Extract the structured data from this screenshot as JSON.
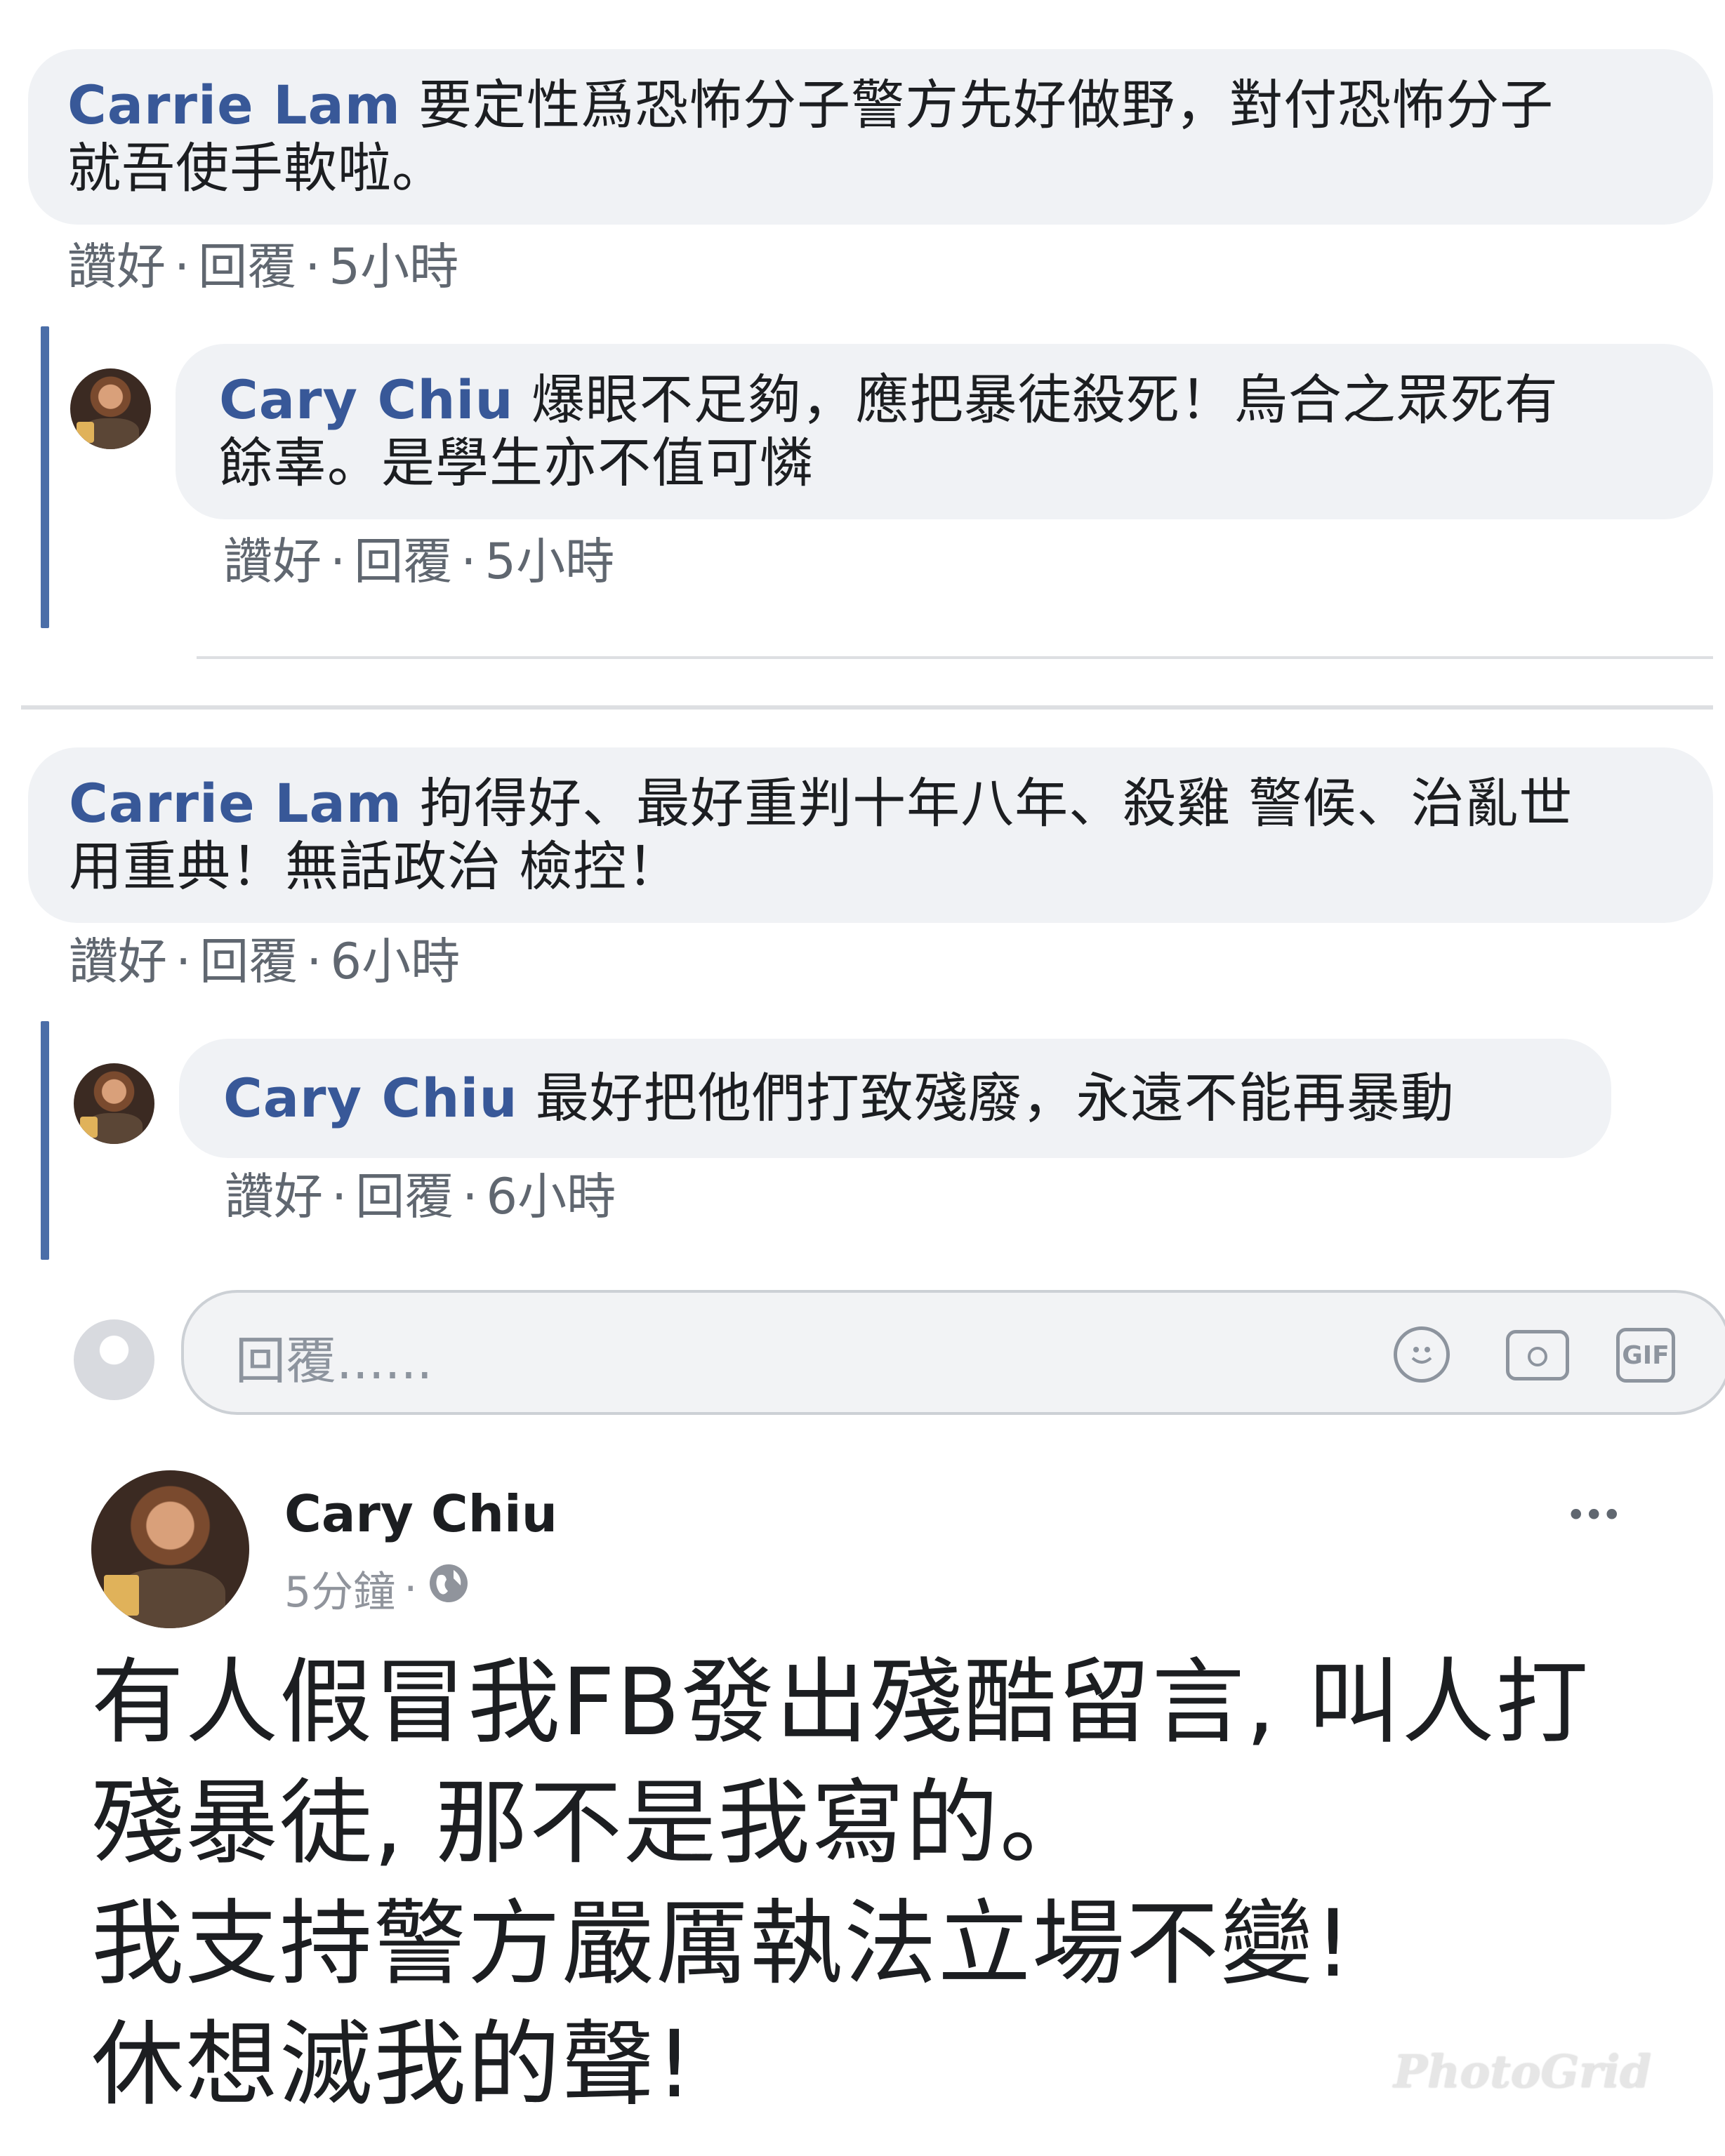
{
  "thread1": {
    "comment": {
      "author": "Carrie Lam",
      "text_line1": "要定性爲恐怖分子警方先好做野，對付恐怖分子",
      "text_line2": "就吾使手軟啦。",
      "like": "讚好",
      "reply": "回覆",
      "time": "5小時"
    },
    "reply": {
      "author": "Cary Chiu",
      "text_line1": "爆眼不足夠，應把暴徒殺死！烏合之眾死有",
      "text_line2": "餘辜。是學生亦不值可憐",
      "like": "讚好",
      "reply": "回覆",
      "time": "5小時"
    }
  },
  "thread2": {
    "comment": {
      "author": "Carrie Lam",
      "text_line1": "拘得好、最好重判十年八年、殺雞 警候、治亂世",
      "text_line2": "用重典！無話政治 檢控！",
      "like": "讚好",
      "reply": "回覆",
      "time": "6小時"
    },
    "reply": {
      "author": "Cary Chiu",
      "text": "最好把他們打致殘廢，永遠不能再暴動",
      "like": "讚好",
      "reply": "回覆",
      "time": "6小時"
    },
    "reply_box": {
      "placeholder": "回覆......",
      "icons": [
        "emoji-icon",
        "camera-icon",
        "gif-icon"
      ],
      "gif_label": "GIF"
    }
  },
  "post": {
    "author": "Cary Chiu",
    "time": "5分鐘",
    "privacy_icon": "globe-icon",
    "more_label": "•••",
    "lines": [
      "有人假冒我FB發出殘酷留言, 叫人打",
      "殘暴徒, 那不是我寫的。",
      "我支持警方嚴厲執法立場不變!",
      "休想滅我的聲!"
    ]
  },
  "watermark": "PhotoGrid",
  "separator_dot": "·"
}
